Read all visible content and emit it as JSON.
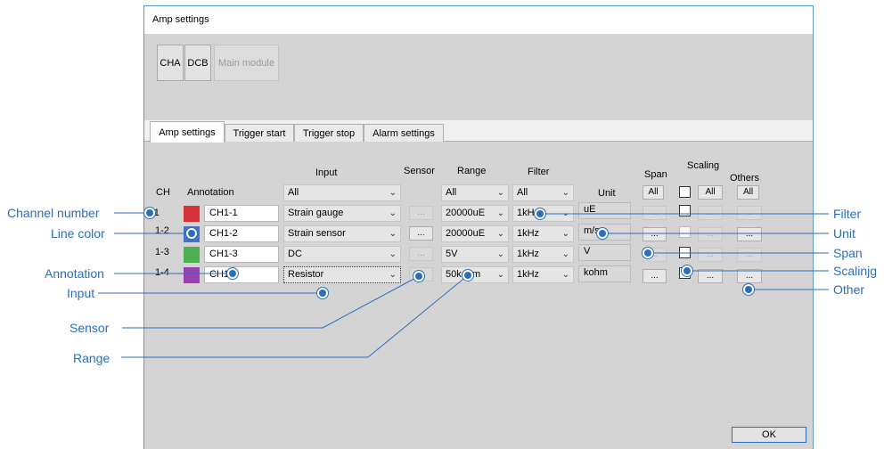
{
  "window": {
    "title": "Amp settings"
  },
  "modules": [
    {
      "label": "CHA",
      "enabled": true
    },
    {
      "label": "DCB",
      "enabled": true
    },
    {
      "label": "Main module",
      "enabled": false
    }
  ],
  "tabs": [
    "Amp settings",
    "Trigger start",
    "Trigger stop",
    "Alarm settings"
  ],
  "headers": {
    "ch": "CH",
    "annotation": "Annotation",
    "input": "Input",
    "sensor": "Sensor",
    "range": "Range",
    "filter": "Filter",
    "unit": "Unit",
    "span": "Span",
    "scaling": "Scaling",
    "others": "Others"
  },
  "all_row": {
    "input": "All",
    "range": "All",
    "filter": "All",
    "span": "All",
    "scaling": "All",
    "others": "All"
  },
  "rows": [
    {
      "ch": "1-1",
      "color": "#d7333c",
      "annotation": "CH1-1",
      "input": "Strain gauge",
      "sensor": "...",
      "range": "20000uE",
      "filter": "1kHz",
      "unit": "uE",
      "span": "...",
      "scaling": "...",
      "others": "..."
    },
    {
      "ch": "1-2",
      "color": "#4472c4",
      "annotation": "CH1-2",
      "input": "Strain sensor",
      "sensor": "...",
      "range": "20000uE",
      "filter": "1kHz",
      "unit": "m/s",
      "span": "...",
      "scaling": "...",
      "others": "..."
    },
    {
      "ch": "1-3",
      "color": "#4caf50",
      "annotation": "CH1-3",
      "input": "DC",
      "sensor": "...",
      "range": "5V",
      "filter": "1kHz",
      "unit": "V",
      "span": "...",
      "scaling": "...",
      "others": "..."
    },
    {
      "ch": "1-4",
      "color": "#9c3fb0",
      "annotation": "CH1-4",
      "input": "Resistor",
      "sensor": "...",
      "range": "50kohm",
      "filter": "1kHz",
      "unit": "kohm",
      "span": "...",
      "scaling": "...",
      "others": "..."
    }
  ],
  "ok_label": "OK",
  "callouts": {
    "channel_number": "Channel number",
    "line_color": "Line color",
    "annotation": "Annotation",
    "input": "Input",
    "sensor": "Sensor",
    "range": "Range",
    "filter": "Filter",
    "unit": "Unit",
    "span": "Span",
    "scaling": "Scalinjg",
    "other": "Other"
  },
  "colors": {
    "callout": "#2a6ebb",
    "window_bg": "#d4d4d4",
    "window_border": "#5b9bd5"
  }
}
